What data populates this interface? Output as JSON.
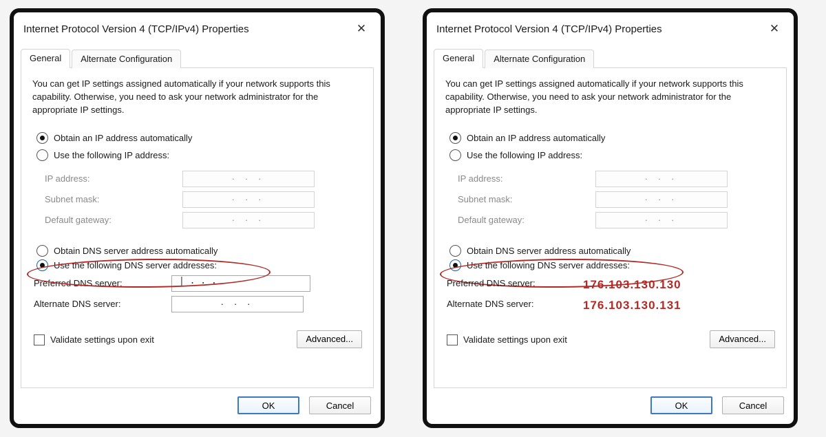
{
  "title": "Internet Protocol Version 4 (TCP/IPv4) Properties",
  "tabs": {
    "general": "General",
    "alternate": "Alternate Configuration"
  },
  "intro": "You can get IP settings assigned automatically if your network supports this capability. Otherwise, you need to ask your network administrator for the appropriate IP settings.",
  "radio_auto_ip": "Obtain an IP address automatically",
  "radio_manual_ip": "Use the following IP address:",
  "ip_address_label": "IP address:",
  "subnet_label": "Subnet mask:",
  "gateway_label": "Default gateway:",
  "ip_dots": ".     .     .",
  "radio_auto_dns": "Obtain DNS server address automatically",
  "radio_manual_dns": "Use the following DNS server addresses:",
  "preferred_dns_label": "Preferred DNS server:",
  "alternate_dns_label": "Alternate DNS server:",
  "validate_label": "Validate settings upon exit",
  "advanced_btn": "Advanced...",
  "ok_btn": "OK",
  "cancel_btn": "Cancel",
  "left": {
    "preferred_dns_value": "|    .     .     .",
    "alternate_dns_value": ".     .     ."
  },
  "right": {
    "preferred_overlay": "176.103.130.130",
    "alternate_overlay": "176.103.130.131"
  },
  "colors": {
    "accent": "#b12a26",
    "highlight": "#0067c0"
  }
}
